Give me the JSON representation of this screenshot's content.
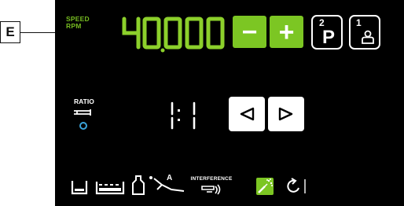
{
  "callout": {
    "label": "E"
  },
  "speed": {
    "label_line1": "SPEED",
    "label_line2": "RPM",
    "value": "40,000",
    "minus_label": "−",
    "plus_label": "+"
  },
  "program": {
    "number": "2",
    "letter": "P"
  },
  "user": {
    "number": "1"
  },
  "ratio": {
    "label": "RATIO",
    "value": "1:1",
    "indicator_color": "#3aa3d9"
  },
  "bottom": {
    "interference_label": "INTERFERENCE",
    "a_label": "A"
  },
  "colors": {
    "accent_green": "#7cc623",
    "display_green": "#8cd02b",
    "panel_bg": "#000000",
    "indicator_blue": "#3aa3d9"
  }
}
